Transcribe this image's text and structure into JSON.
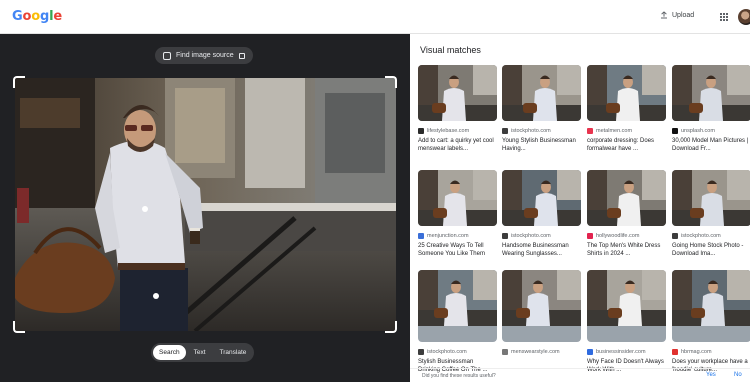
{
  "header": {
    "logo_letters": [
      {
        "ch": "G",
        "color": "#4285f4"
      },
      {
        "ch": "o",
        "color": "#ea4335"
      },
      {
        "ch": "o",
        "color": "#fbbc05"
      },
      {
        "ch": "g",
        "color": "#4285f4"
      },
      {
        "ch": "l",
        "color": "#34a853"
      },
      {
        "ch": "e",
        "color": "#ea4335"
      }
    ],
    "upload_label": "Upload",
    "upload_icon": "upload-icon",
    "apps_icon": "apps-grid-icon"
  },
  "viewer": {
    "find_source_label": "Find image source",
    "tabs": [
      {
        "label": "Search",
        "active": true
      },
      {
        "label": "Text",
        "active": false
      },
      {
        "label": "Translate",
        "active": false
      }
    ]
  },
  "results": {
    "title": "Visual matches",
    "cards": [
      {
        "source": "lifestylebase.com",
        "title": "Add to cart: a quirky yet cool menswear labels...",
        "favicon": "#2b2b2b"
      },
      {
        "source": "istockphoto.com",
        "title": "Young Stylish Businessman Having...",
        "favicon": "#3d3d3d"
      },
      {
        "source": "metalmen.com",
        "title": "corporate dressing: Does formalwear have ...",
        "favicon": "#e8344e"
      },
      {
        "source": "unsplash.com",
        "title": "30,000 Model Man Pictures | Download Fr...",
        "favicon": "#111111"
      },
      {
        "source": "menjunction.com",
        "title": "25 Creative Ways To Tell Someone You Like Them",
        "favicon": "#3a6fd8"
      },
      {
        "source": "istockphoto.com",
        "title": "Handsome Businessman Wearing Sunglasses...",
        "favicon": "#3d3d3d"
      },
      {
        "source": "hollywoodlife.com",
        "title": "The Top Men's White Dress Shirts in 2024 ...",
        "favicon": "#e2234f"
      },
      {
        "source": "istockphoto.com",
        "title": "Going Home Stock Photo - Download Ima...",
        "favicon": "#3d3d3d"
      },
      {
        "source": "istockphoto.com",
        "title": "Stylish Businessman Drinking Coffee On The ...",
        "favicon": "#3d3d3d"
      },
      {
        "source": "menswearstyle.com",
        "title": "",
        "favicon": "#777777"
      },
      {
        "source": "businessinsider.com",
        "title": "Why Face ID Doesn't Always Work With ...",
        "favicon": "#2f6be0"
      },
      {
        "source": "hbrmag.com",
        "title": "Does your workplace have a 'hoodie' culture...",
        "favicon": "#e0312f"
      }
    ]
  },
  "feedback": {
    "question": "Did you find these results useful?",
    "yes_label": "Yes",
    "no_label": "No"
  }
}
